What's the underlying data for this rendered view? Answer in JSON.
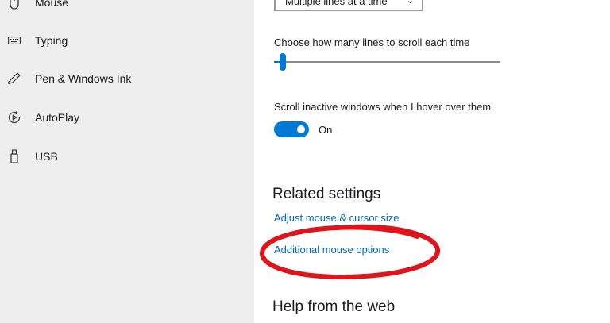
{
  "sidebar": {
    "items": [
      {
        "label": "Mouse",
        "icon": "mouse-icon"
      },
      {
        "label": "Typing",
        "icon": "keyboard-icon"
      },
      {
        "label": "Pen & Windows Ink",
        "icon": "pen-icon"
      },
      {
        "label": "AutoPlay",
        "icon": "autoplay-icon"
      },
      {
        "label": "USB",
        "icon": "usb-icon"
      }
    ]
  },
  "scroll": {
    "mode_value": "Multiple lines at a time",
    "lines_label": "Choose how many lines to scroll each time",
    "lines_value_fraction": 0.03,
    "inactive_label": "Scroll inactive windows when I hover over them",
    "inactive_state": "On"
  },
  "related": {
    "heading": "Related settings",
    "links": [
      "Adjust mouse & cursor size",
      "Additional mouse options"
    ]
  },
  "help": {
    "heading": "Help from the web"
  },
  "colors": {
    "accent": "#0078d7",
    "link": "#0067b8",
    "annotation": "#e0141b",
    "sidebar_bg": "#eeeeee"
  }
}
